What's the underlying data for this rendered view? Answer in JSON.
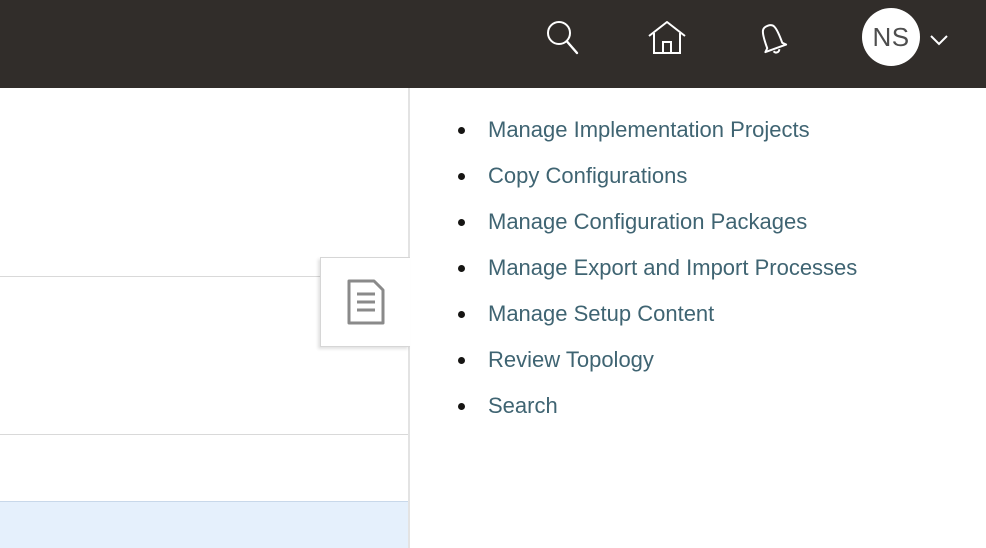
{
  "header": {
    "icons": {
      "search": "search-icon",
      "home": "home-icon",
      "notifications": "bell-icon",
      "user_menu": "chevron-down-icon"
    },
    "avatar_initials": "NS",
    "colors": {
      "bar": "#312d2a",
      "icon": "#ffffff"
    }
  },
  "drawer": {
    "tab_icon": "document-list-icon",
    "tasks": [
      {
        "label": "Manage Implementation Projects"
      },
      {
        "label": "Copy Configurations"
      },
      {
        "label": "Manage Configuration Packages"
      },
      {
        "label": "Manage Export and Import Processes"
      },
      {
        "label": "Manage Setup Content"
      },
      {
        "label": "Review Topology"
      },
      {
        "label": "Search"
      }
    ],
    "colors": {
      "link": "#3f6472"
    }
  }
}
